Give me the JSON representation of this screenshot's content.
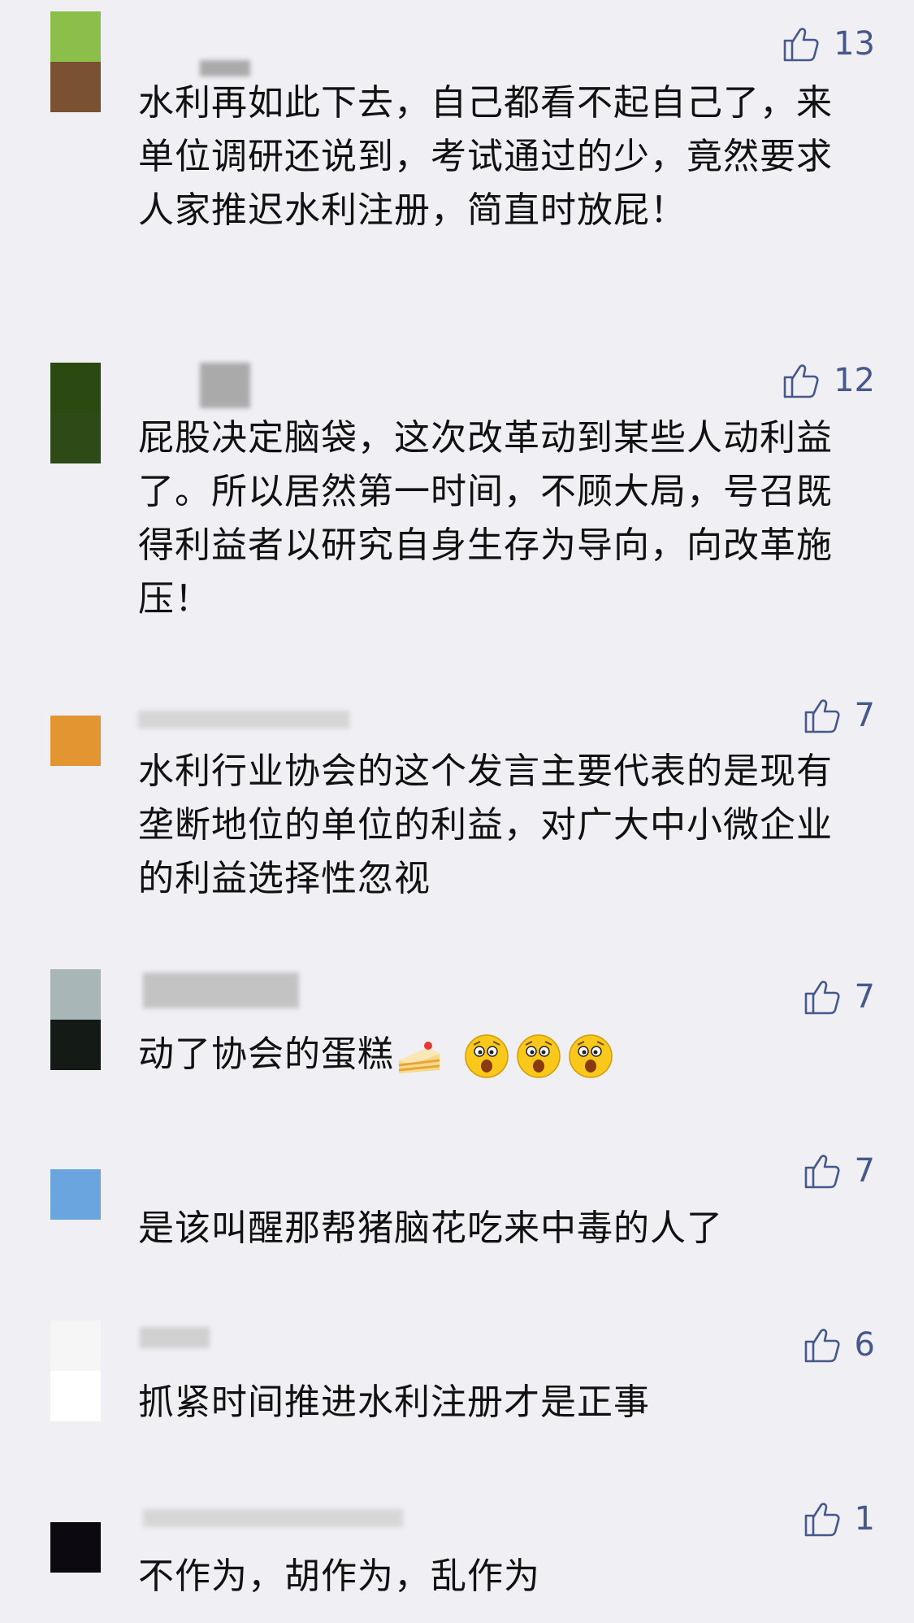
{
  "comments": [
    {
      "likes": "13",
      "text": "水利再如此下去，自己都看不起自己了，来单位调研还说到，考试通过的少，竟然要求人家推迟水利注册，简直时放屁！",
      "avatar_top": "#8bbf4a",
      "avatar_bottom": "#7a5232"
    },
    {
      "likes": "12",
      "text": "屁股决定脑袋，这次改革动到某些人动利益了。所以居然第一时间，不顾大局，号召既得利益者以研究自身生存为导向，向改革施压！",
      "avatar_top": "#2b4a12",
      "avatar_bottom": "#2e4a16"
    },
    {
      "likes": "7",
      "text": "水利行业协会的这个发言主要代表的是现有垄断地位的单位的利益，对广大中小微企业的利益选择性忽视",
      "avatar_top": "#e29530"
    },
    {
      "likes": "7",
      "text": "动了协会的蛋糕",
      "emoji": [
        "cake",
        "surprised-face",
        "surprised-face",
        "surprised-face"
      ],
      "avatar_top": "#a9b6b8",
      "avatar_bottom": "#141a16"
    },
    {
      "likes": "7",
      "text": "是该叫醒那帮猪脑花吃来中毒的人了",
      "avatar_top": "#6ba5df"
    },
    {
      "likes": "6",
      "text": "抓紧时间推进水利注册才是正事",
      "avatar_top": "#f6f6f6",
      "avatar_bottom": "#ffffff"
    },
    {
      "likes": "1",
      "text": "不作为，胡作为，乱作为",
      "avatar_top": "#0c0a10"
    }
  ],
  "icon": "thumbs-up-icon",
  "colors": {
    "background": "#efeff4",
    "like_count": "#46588c",
    "text": "#111111"
  }
}
